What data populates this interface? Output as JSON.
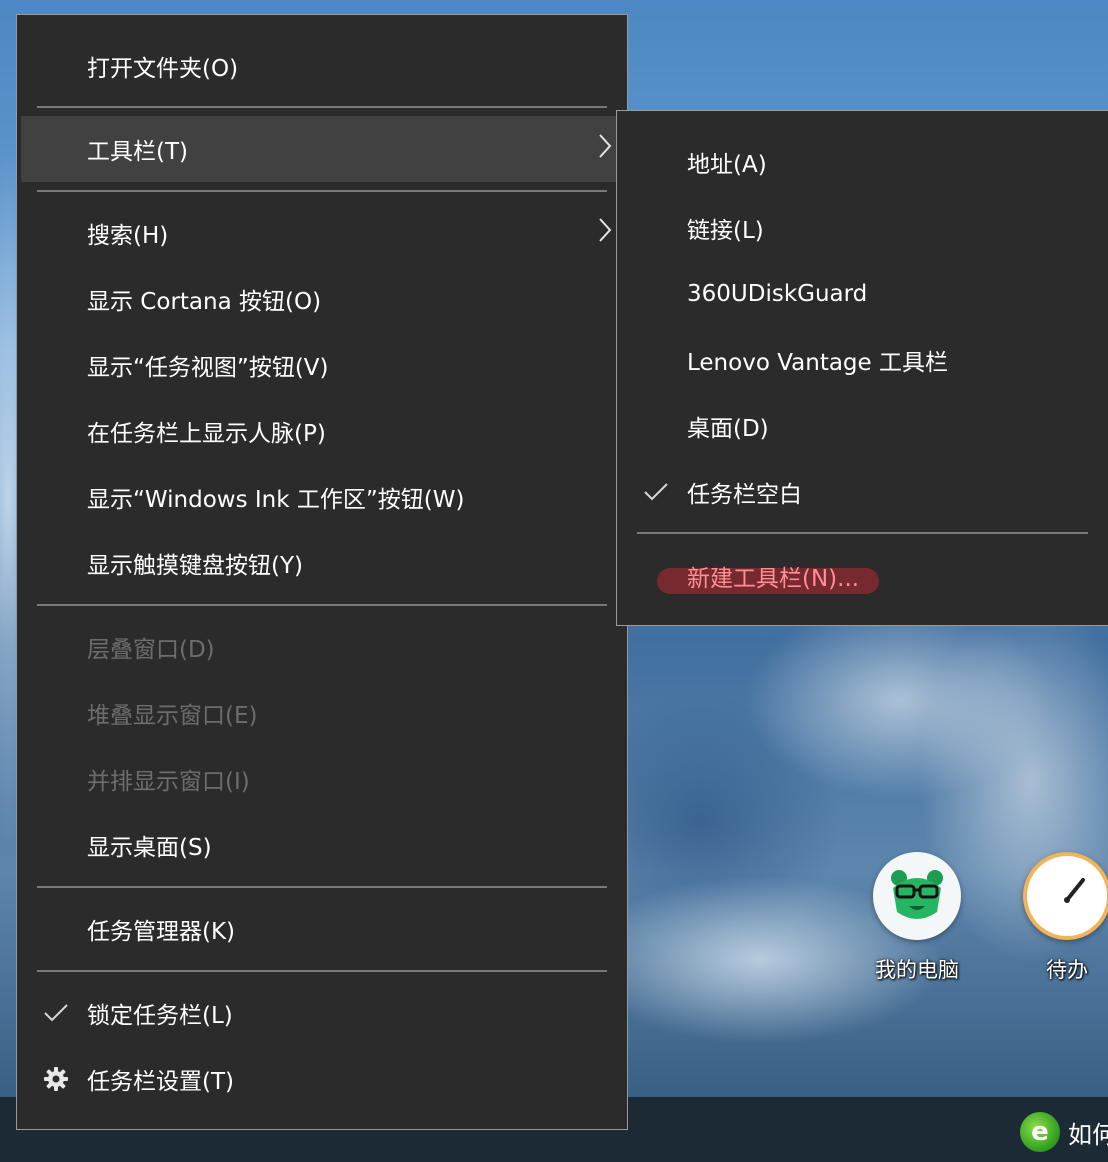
{
  "main_menu": {
    "items": [
      {
        "label": "打开文件夹(O)"
      },
      {
        "label": "工具栏(T)"
      },
      {
        "label": "搜索(H)"
      },
      {
        "label": "显示 Cortana 按钮(O)"
      },
      {
        "label": "显示“任务视图”按钮(V)"
      },
      {
        "label": "在任务栏上显示人脉(P)"
      },
      {
        "label": "显示“Windows Ink 工作区”按钮(W)"
      },
      {
        "label": "显示触摸键盘按钮(Y)"
      },
      {
        "label": "层叠窗口(D)"
      },
      {
        "label": "堆叠显示窗口(E)"
      },
      {
        "label": "并排显示窗口(I)"
      },
      {
        "label": "显示桌面(S)"
      },
      {
        "label": "任务管理器(K)"
      },
      {
        "label": "锁定任务栏(L)",
        "checked": true
      },
      {
        "label": "任务栏设置(T)",
        "icon": "gear-icon"
      }
    ]
  },
  "sub_menu": {
    "items": [
      {
        "label": "地址(A)"
      },
      {
        "label": "链接(L)"
      },
      {
        "label": "360UDiskGuard"
      },
      {
        "label": "Lenovo Vantage 工具栏"
      },
      {
        "label": "桌面(D)"
      },
      {
        "label": "任务栏空白",
        "checked": true
      },
      {
        "label": "新建工具栏(N)..."
      }
    ]
  },
  "desktop": {
    "icons": [
      {
        "label": "我的电脑",
        "icon": "bear-icon"
      },
      {
        "label": "待办",
        "icon": "clock-icon"
      }
    ],
    "taskbar_app": {
      "label": "如何",
      "icon": "green-logo-icon"
    }
  },
  "colors": {
    "menu_bg": "#2b2b2b",
    "menu_hover": "#414141",
    "menu_text": "#ffffff",
    "disabled_text": "#6d6d6d",
    "highlight": "#ff8f95"
  }
}
